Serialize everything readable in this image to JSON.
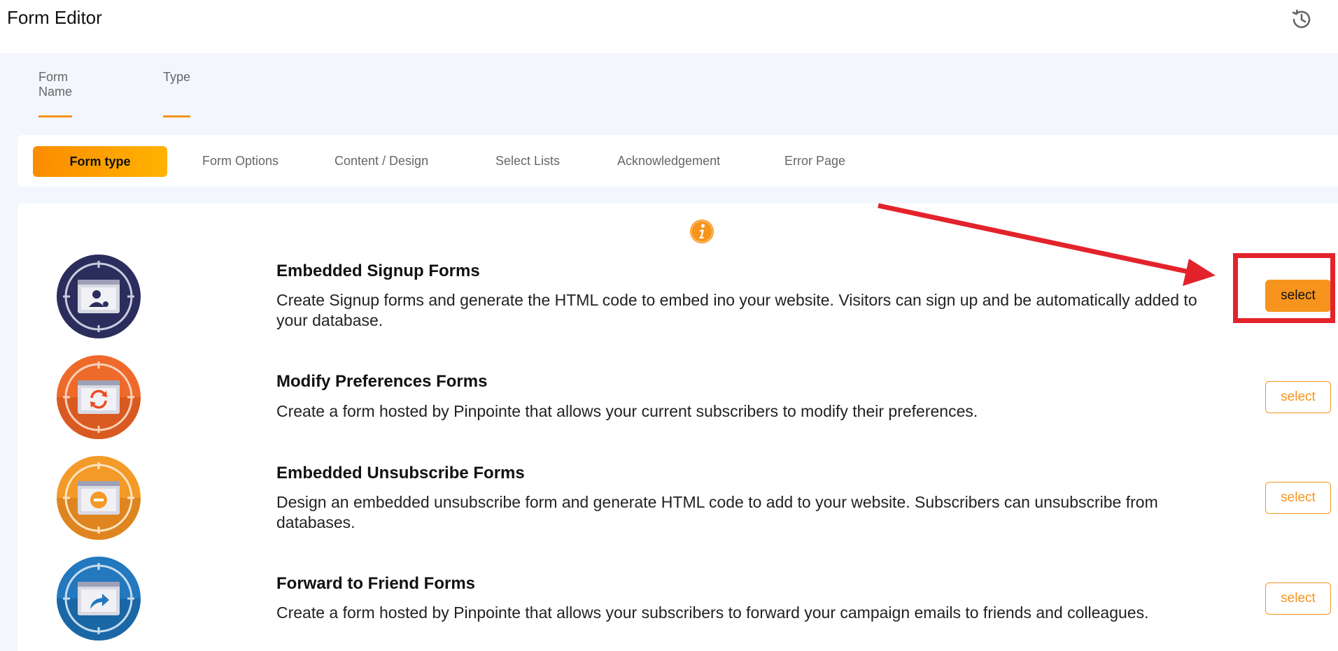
{
  "header": {
    "title": "Form Editor",
    "history_icon": "history-icon"
  },
  "field_tabs": [
    {
      "label": "Form Name"
    },
    {
      "label": "Type"
    }
  ],
  "steps": [
    {
      "label": "Form type",
      "active": true
    },
    {
      "label": "Form Options"
    },
    {
      "label": "Content / Design"
    },
    {
      "label": "Select Lists"
    },
    {
      "label": "Acknowledgement"
    },
    {
      "label": "Error Page"
    }
  ],
  "form_types": [
    {
      "title": "Embedded Signup Forms",
      "description": "Create Signup forms and generate the HTML code to embed ino your website. Visitors can sign up and be automatically added to your database.",
      "button": "select",
      "icon": "signup-form-icon",
      "color": "#2b2d5c"
    },
    {
      "title": "Modify Preferences Forms",
      "description": "Create a form hosted by Pinpointe that allows your current subscribers to modify their preferences.",
      "button": "select",
      "icon": "preferences-form-icon",
      "color": "#ee6a2b"
    },
    {
      "title": "Embedded Unsubscribe Forms",
      "description": "Design an embedded unsubscribe form and generate HTML code to add to your website. Subscribers can unsubscribe from databases.",
      "button": "select",
      "icon": "unsubscribe-form-icon",
      "color": "#f39a28"
    },
    {
      "title": "Forward to Friend Forms",
      "description": "Create a form hosted by Pinpointe that allows your subscribers to forward your campaign emails to friends and colleagues.",
      "button": "select",
      "icon": "forward-form-icon",
      "color": "#2378be"
    }
  ],
  "colors": {
    "accent": "#f7941d",
    "annotation": "#e3232c"
  }
}
